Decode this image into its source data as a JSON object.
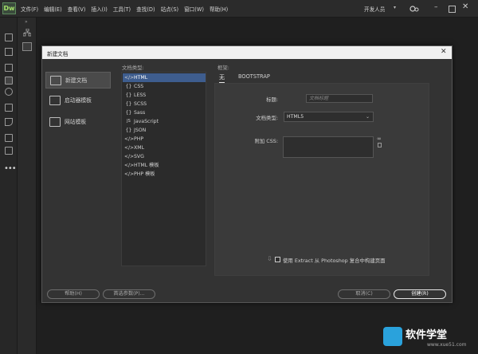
{
  "app": {
    "logo_text": "Dw",
    "menu": [
      "文件(F)",
      "编辑(E)",
      "查看(V)",
      "插入(I)",
      "工具(T)",
      "查找(D)",
      "站点(S)",
      "窗口(W)",
      "帮助(H)"
    ],
    "workspace": "开发人员",
    "icons": [
      "sync-icon",
      "gear-icon",
      "minimize-icon",
      "maximize-icon",
      "close-icon"
    ]
  },
  "dialog": {
    "title": "新建文档",
    "categories": [
      {
        "label": "新建文档",
        "icon": "new-document-icon",
        "selected": true
      },
      {
        "label": "启动器模板",
        "icon": "starter-template-icon",
        "selected": false
      },
      {
        "label": "网站模板",
        "icon": "site-template-icon",
        "selected": false
      }
    ],
    "doctype_label": "文档类型:",
    "doctypes": [
      {
        "label": "HTML",
        "icon": "</>",
        "selected": true
      },
      {
        "label": "CSS",
        "icon": "{}",
        "selected": false
      },
      {
        "label": "LESS",
        "icon": "{}",
        "selected": false
      },
      {
        "label": "SCSS",
        "icon": "{}",
        "selected": false
      },
      {
        "label": "Sass",
        "icon": "{}",
        "selected": false
      },
      {
        "label": "JavaScript",
        "icon": "JS",
        "selected": false
      },
      {
        "label": "JSON",
        "icon": "{}",
        "selected": false
      },
      {
        "label": "PHP",
        "icon": "</>",
        "selected": false
      },
      {
        "label": "XML",
        "icon": "</>",
        "selected": false
      },
      {
        "label": "SVG",
        "icon": "</>",
        "selected": false
      },
      {
        "label": "HTML 模板",
        "icon": "</>",
        "selected": false
      },
      {
        "label": "PHP 模板",
        "icon": "</>",
        "selected": false
      }
    ],
    "framework_label": "框架:",
    "framework_tabs": [
      "无",
      "BOOTSTRAP"
    ],
    "fields": {
      "title_label": "标题:",
      "title_placeholder": "文档标题",
      "doctype_label": "文档类型:",
      "doctype_value": "HTML5",
      "css_label": "附加 CSS:"
    },
    "extract_label": "使用 Extract 从 Photoshop 复合中构建页面",
    "buttons": {
      "help": "帮助(H)",
      "prefs": "首选参数(P)...",
      "cancel": "取消(C)",
      "create": "创建(R)"
    }
  },
  "watermark": {
    "text": "软件学堂",
    "url": "www.xue51.com"
  }
}
